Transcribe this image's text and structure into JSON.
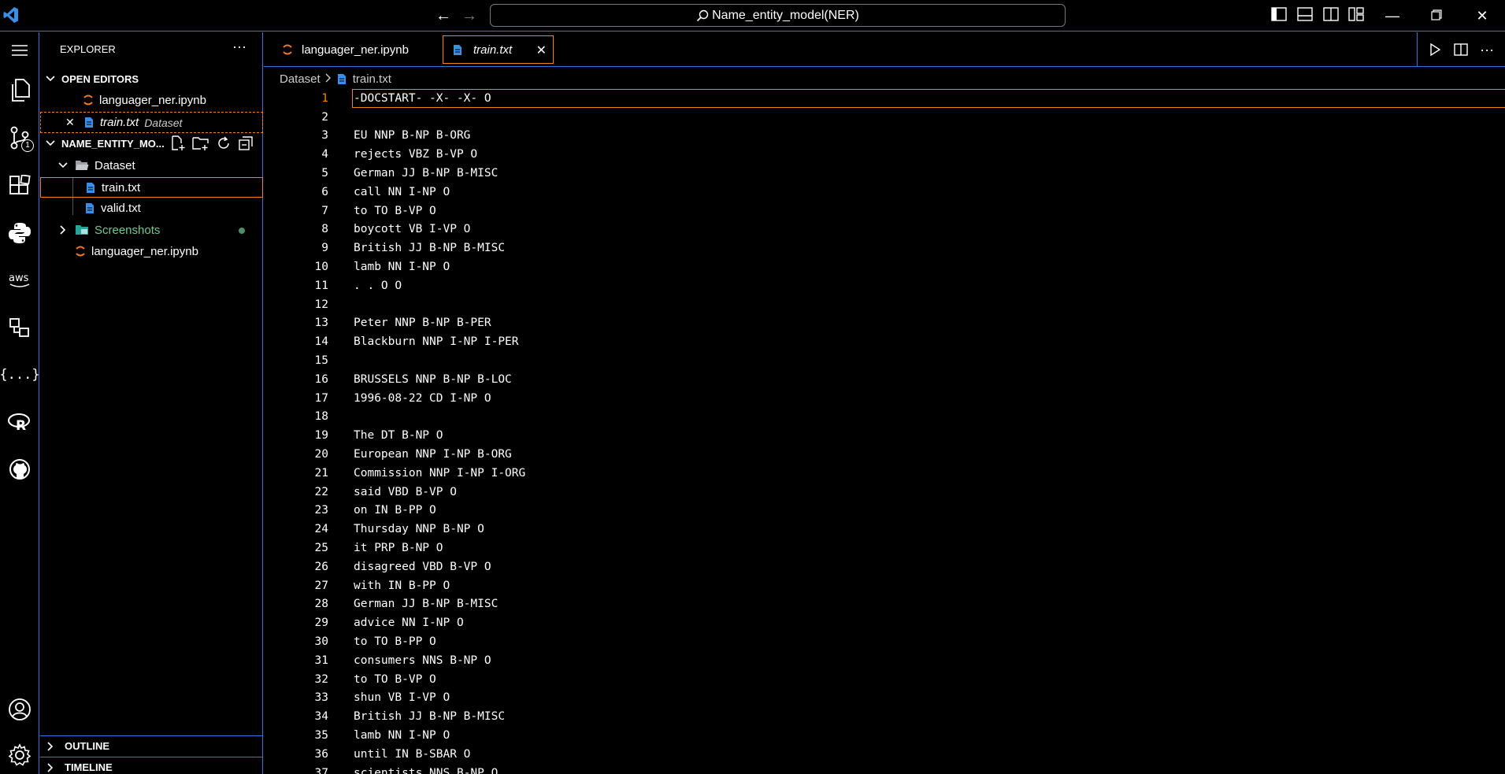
{
  "titlebar": {
    "search_text": "Name_entity_model(NER)"
  },
  "activity_bar": {
    "scm_badge": "1",
    "items": [
      "explorer-icon",
      "source-control-icon",
      "extensions-icon",
      "python-icon",
      "aws-icon",
      "remote-explorer-icon",
      "json-icon",
      "r-icon",
      "github-icon"
    ]
  },
  "sidebar": {
    "title": "EXPLORER",
    "open_editors": {
      "title": "OPEN EDITORS",
      "items": [
        {
          "name": "languager_ner.ipynb",
          "desc": ""
        },
        {
          "name": "train.txt",
          "desc": "Dataset"
        }
      ]
    },
    "project": {
      "title": "NAME_ENTITY_MO...",
      "folder": "Dataset",
      "files": [
        "train.txt",
        "valid.txt"
      ],
      "screenshots": "Screenshots",
      "notebook": "languager_ner.ipynb"
    },
    "outline": "OUTLINE",
    "timeline": "TIMELINE"
  },
  "tabs": [
    {
      "label": "languager_ner.ipynb",
      "active": false
    },
    {
      "label": "train.txt",
      "active": true
    }
  ],
  "breadcrumb": {
    "folder": "Dataset",
    "file": "train.txt"
  },
  "editor": {
    "current_line": 1,
    "lines": [
      "-DOCSTART- -X- -X- O",
      "",
      "EU NNP B-NP B-ORG",
      "rejects VBZ B-VP O",
      "German JJ B-NP B-MISC",
      "call NN I-NP O",
      "to TO B-VP O",
      "boycott VB I-VP O",
      "British JJ B-NP B-MISC",
      "lamb NN I-NP O",
      ". . O O",
      "",
      "Peter NNP B-NP B-PER",
      "Blackburn NNP I-NP I-PER",
      "",
      "BRUSSELS NNP B-NP B-LOC",
      "1996-08-22 CD I-NP O",
      "",
      "The DT B-NP O",
      "European NNP I-NP B-ORG",
      "Commission NNP I-NP I-ORG",
      "said VBD B-VP O",
      "on IN B-PP O",
      "Thursday NNP B-NP O",
      "it PRP B-NP O",
      "disagreed VBD B-VP O",
      "with IN B-PP O",
      "German JJ B-NP B-MISC",
      "advice NN I-NP O",
      "to TO B-PP O",
      "consumers NNS B-NP O",
      "to TO B-VP O",
      "shun VB I-VP O",
      "British JJ B-NP B-MISC",
      "lamb NN I-NP O",
      "until IN B-SBAR O",
      "scientists NNS B-NP O"
    ]
  },
  "colors": {
    "accent": "#2b79d8",
    "focus": "#f38518",
    "file_icon": "#3b8eea",
    "notebook_icon": "#f37726",
    "git_added": "#73c991"
  }
}
